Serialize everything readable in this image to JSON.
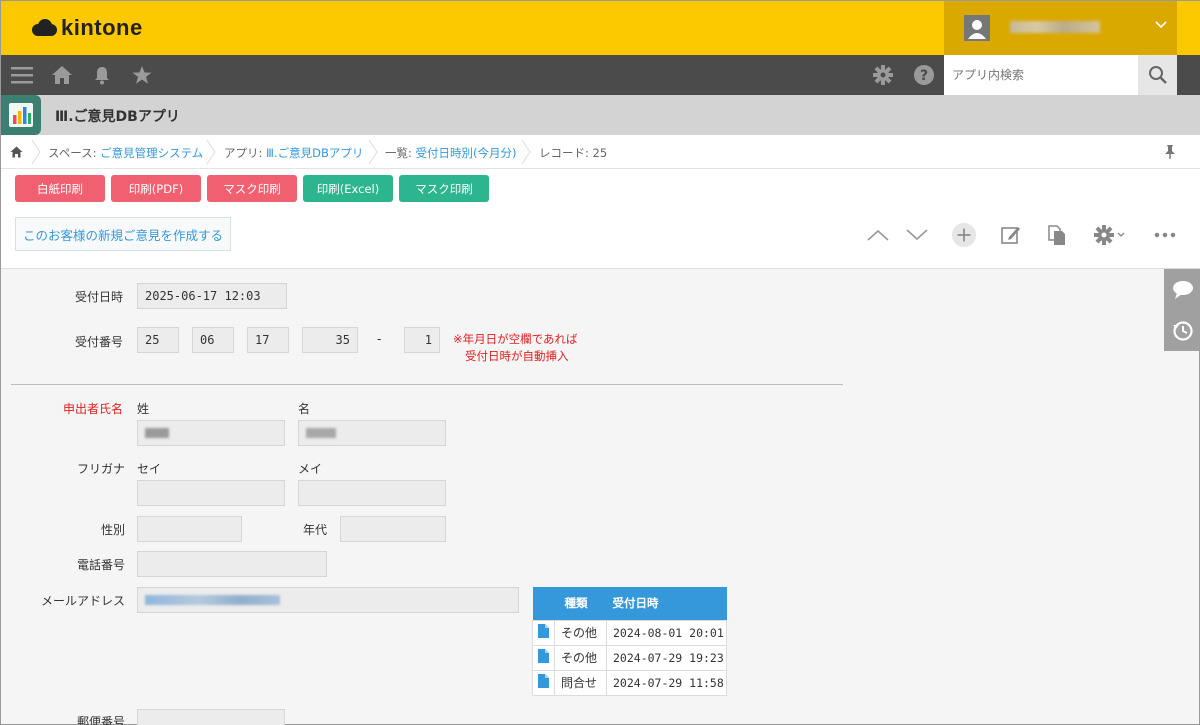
{
  "header": {
    "logo_text": "kintone",
    "user_name": "",
    "brand_color": "#fcc800"
  },
  "nav": {
    "menu_icon": "hamburger-icon",
    "home_icon": "home-icon",
    "notify_icon": "bell-icon",
    "favorite_icon": "star-icon",
    "settings_icon": "gear-icon",
    "help_icon": "help-icon",
    "search_placeholder": "アプリ内検索",
    "search_icon": "search-icon"
  },
  "app": {
    "title": "Ⅲ.ご意見DBアプリ",
    "icon": "bar-chart-icon"
  },
  "breadcrumb": {
    "space_prefix": "スペース: ",
    "space_name": "ご意見管理システム",
    "app_prefix": "アプリ: ",
    "app_name": "Ⅲ.ご意見DBアプリ",
    "view_prefix": "一覧: ",
    "view_name": "受付日時別(今月分)",
    "record": "レコード: 25"
  },
  "toolbar": {
    "print_buttons": [
      {
        "label": "白紙印刷",
        "color": "#f06070"
      },
      {
        "label": "印刷(PDF)",
        "color": "#f06070"
      },
      {
        "label": "マスク印刷",
        "color": "#f06070"
      },
      {
        "label": "印刷(Excel)",
        "color": "#2cb58f"
      },
      {
        "label": "マスク印刷",
        "color": "#2cb58f"
      }
    ],
    "create_label": "このお客様の新規ご意見を作成する"
  },
  "form": {
    "received_at_label": "受付日時",
    "received_at_value": "2025-06-17 12:03",
    "receipt_no_label": "受付番号",
    "receipt_no": [
      "25",
      "06",
      "17",
      "35"
    ],
    "receipt_dash": "-",
    "receipt_seq": "1",
    "receipt_note_1": "※年月日が空欄であれば",
    "receipt_note_2": "受付日時が自動挿入",
    "name_label": "申出者氏名",
    "last_name_label": "姓",
    "first_name_label": "名",
    "kana_label": "フリガナ",
    "last_kana_label": "セイ",
    "first_kana_label": "メイ",
    "gender_label": "性別",
    "age_label": "年代",
    "phone_label": "電話番号",
    "email_label": "メールアドレス",
    "postal_label": "郵便番号"
  },
  "related": {
    "col_type": "種類",
    "col_date": "受付日時",
    "rows": [
      {
        "type": "その他",
        "date": "2024-08-01 20:01"
      },
      {
        "type": "その他",
        "date": "2024-07-29 19:23"
      },
      {
        "type": "問合せ",
        "date": "2024-07-29 11:58"
      }
    ],
    "header_color": "#3498db"
  },
  "side": {
    "comment_icon": "comment-icon",
    "history_icon": "history-icon"
  }
}
